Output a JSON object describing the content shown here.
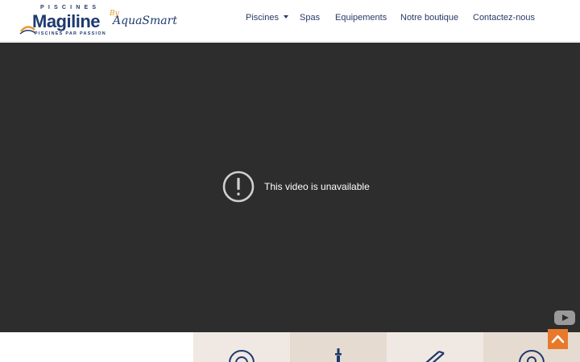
{
  "logo": {
    "top_text": "PISCINES",
    "brand": "Magiline",
    "tagline": "PISCINES PAR PASSION"
  },
  "partner": {
    "by": "By",
    "name": "AquaSmart"
  },
  "nav": {
    "piscines": "Piscines",
    "spas": "Spas",
    "equipements": "Equipements",
    "boutique": "Notre boutique",
    "contact": "Contactez-nous"
  },
  "video": {
    "message": "This video is unavailable"
  },
  "colors": {
    "brand_navy": "#1e3a6e",
    "accent_orange": "#e8792b",
    "video_bg": "#2d2d2d",
    "tile_light": "#f0e8e2",
    "tile_dark": "#e6dbd1"
  },
  "tiles": [
    {
      "icon": "gear-circle-icon"
    },
    {
      "icon": "tower-icon"
    },
    {
      "icon": "tools-icon"
    },
    {
      "icon": "circle-icon"
    }
  ]
}
